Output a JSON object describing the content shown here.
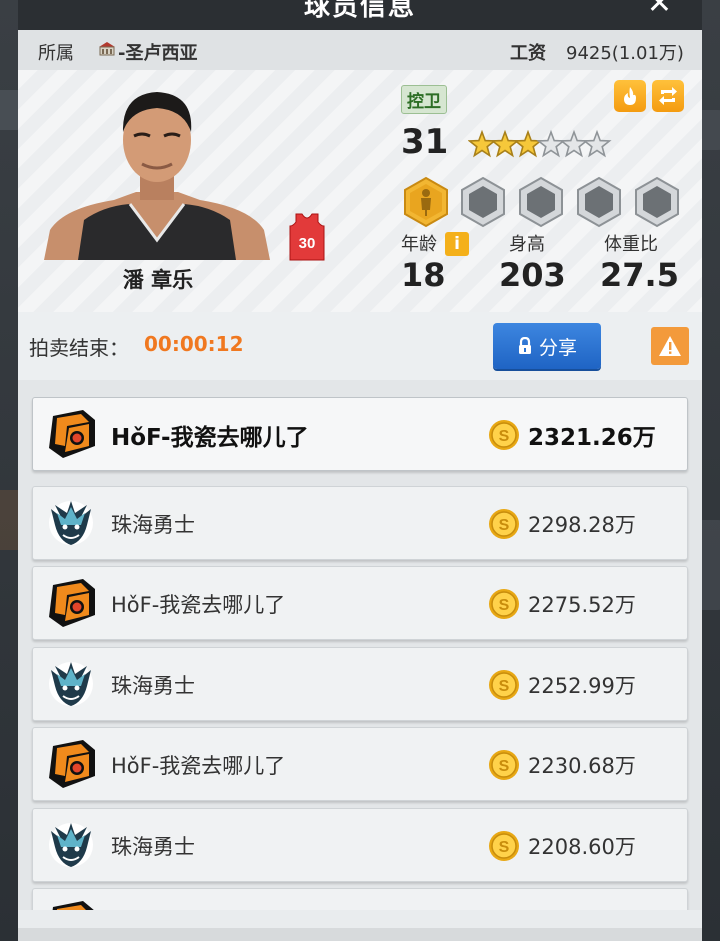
{
  "header": {
    "title": "球员信息"
  },
  "info": {
    "club_label": "所属",
    "club_name": "-圣卢西亚",
    "salary_label": "工资",
    "salary_value": "9425(1.01万)"
  },
  "player": {
    "name": "潘 章乐",
    "jersey_number": "30",
    "position": "控卫",
    "rating": "31",
    "stars_filled": 3,
    "stars_total": 6,
    "age_label": "年龄",
    "age": "18",
    "height_label": "身高",
    "height": "203",
    "bmi_label": "体重比",
    "bmi": "27.5"
  },
  "auction": {
    "label": "拍卖结束：",
    "time": "00:00:12",
    "share_label": "分享"
  },
  "bids": [
    {
      "team": "HǒF-我瓷去哪儿了",
      "amount": "2321.26万",
      "logo": "hof"
    },
    {
      "team": "珠海勇士",
      "amount": "2298.28万",
      "logo": "dragon"
    },
    {
      "team": "HǒF-我瓷去哪儿了",
      "amount": "2275.52万",
      "logo": "hof"
    },
    {
      "team": "珠海勇士",
      "amount": "2252.99万",
      "logo": "dragon"
    },
    {
      "team": "HǒF-我瓷去哪儿了",
      "amount": "2230.68万",
      "logo": "hof"
    },
    {
      "team": "珠海勇士",
      "amount": "2208.60万",
      "logo": "dragon"
    },
    {
      "team": "",
      "amount": "",
      "logo": "hof"
    }
  ],
  "colors": {
    "accent_orange": "#f07820",
    "share_blue": "#2b74d3",
    "gold": "#f4b01a"
  }
}
